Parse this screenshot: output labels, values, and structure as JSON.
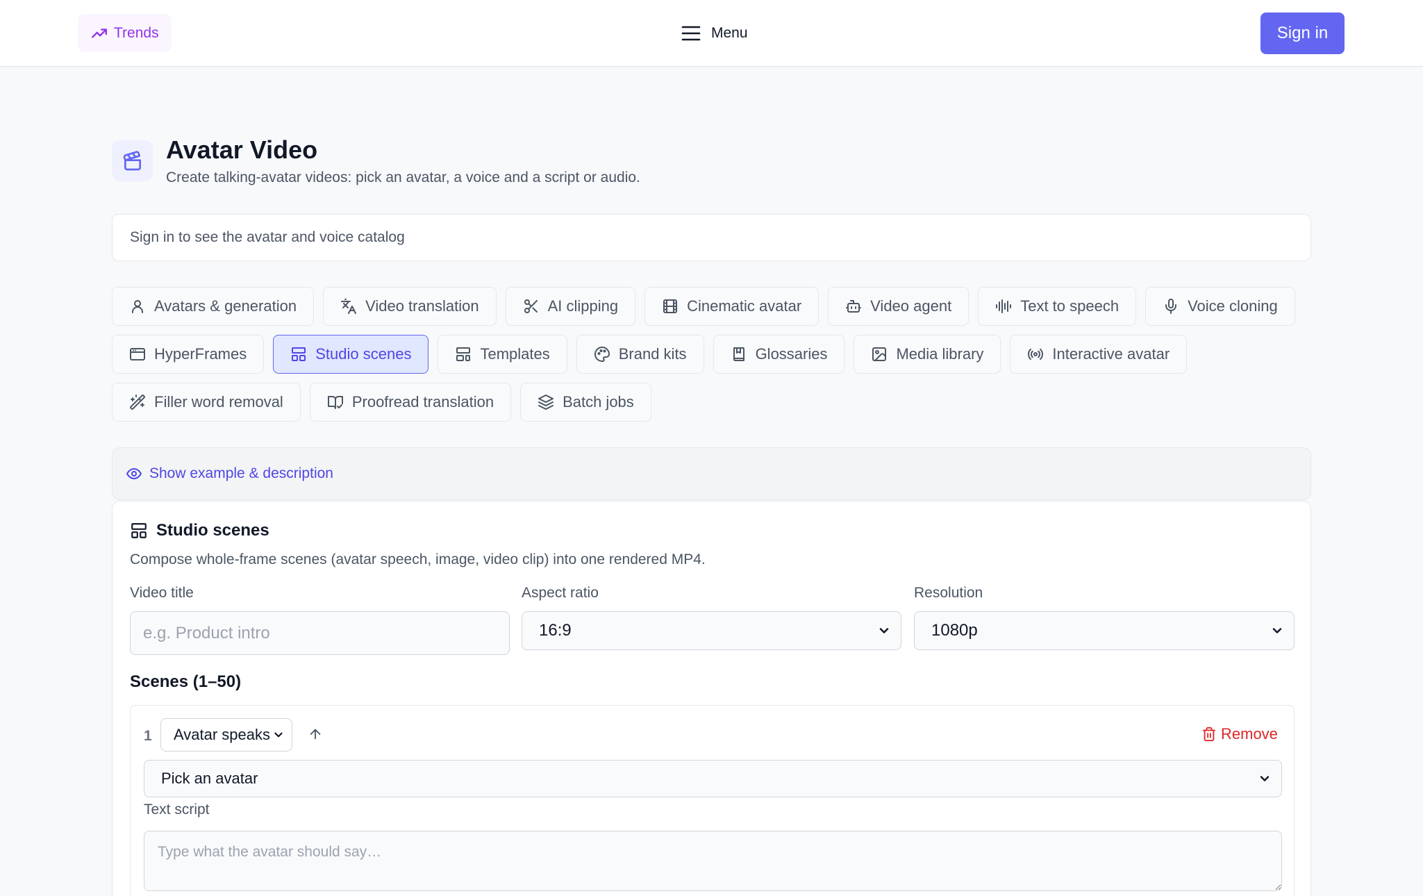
{
  "header": {
    "trends_label": "Trends",
    "menu_label": "Menu",
    "signin_label": "Sign in"
  },
  "page": {
    "title": "Avatar Video",
    "subtitle": "Create talking-avatar videos: pick an avatar, a voice and a script or audio.",
    "catalog_note": "Sign in to see the avatar and voice catalog"
  },
  "tabs": [
    {
      "label": "Avatars & generation",
      "icon": "user-icon"
    },
    {
      "label": "Video translation",
      "icon": "translate-icon"
    },
    {
      "label": "AI clipping",
      "icon": "scissors-icon"
    },
    {
      "label": "Cinematic avatar",
      "icon": "film-icon"
    },
    {
      "label": "Video agent",
      "icon": "bot-icon"
    },
    {
      "label": "Text to speech",
      "icon": "audio-waveform-icon"
    },
    {
      "label": "Voice cloning",
      "icon": "microphone-icon"
    },
    {
      "label": "HyperFrames",
      "icon": "browser-window-icon"
    },
    {
      "label": "Studio scenes",
      "icon": "layout-icon",
      "active": true
    },
    {
      "label": "Templates",
      "icon": "layout-template-icon"
    },
    {
      "label": "Brand kits",
      "icon": "palette-icon"
    },
    {
      "label": "Glossaries",
      "icon": "book-icon"
    },
    {
      "label": "Media library",
      "icon": "image-icon"
    },
    {
      "label": "Interactive avatar",
      "icon": "broadcast-icon"
    },
    {
      "label": "Filler word removal",
      "icon": "magic-wand-icon"
    },
    {
      "label": "Proofread translation",
      "icon": "book-check-icon"
    },
    {
      "label": "Batch jobs",
      "icon": "layers-icon"
    }
  ],
  "example": {
    "label": "Show example & description"
  },
  "studio": {
    "title": "Studio scenes",
    "description": "Compose whole-frame scenes (avatar speech, image, video clip) into one rendered MP4.",
    "video_title_label": "Video title",
    "video_title_placeholder": "e.g. Product intro",
    "aspect_ratio_label": "Aspect ratio",
    "aspect_ratio_value": "16:9",
    "resolution_label": "Resolution",
    "resolution_value": "1080p",
    "scenes_heading": "Scenes (1–50)",
    "scenes": [
      {
        "number": "1",
        "type": "Avatar speaks",
        "remove_label": "Remove",
        "avatar_select": "Pick an avatar",
        "script_label": "Text script",
        "script_placeholder": "Type what the avatar should say…"
      }
    ]
  },
  "colors": {
    "accent": "#6366f1",
    "trends": "#9333ea",
    "danger": "#dc2626"
  }
}
